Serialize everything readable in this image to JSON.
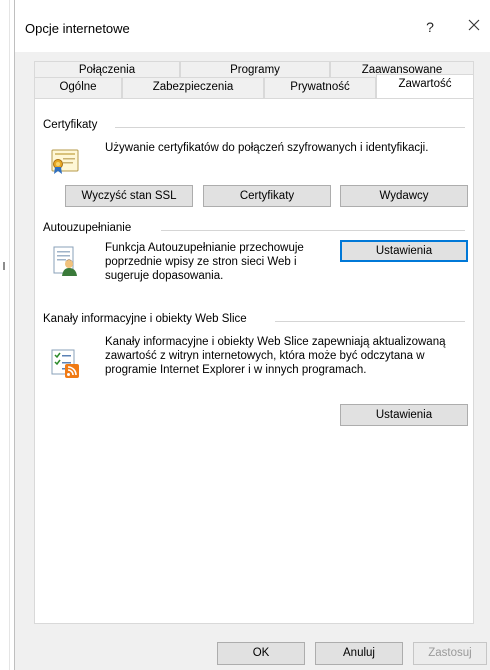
{
  "window": {
    "title": "Opcje internetowe",
    "help_label": "?"
  },
  "tabs": {
    "top_row": [
      {
        "label": "Połączenia"
      },
      {
        "label": "Programy"
      },
      {
        "label": "Zaawansowane"
      }
    ],
    "bottom_row": [
      {
        "label": "Ogólne"
      },
      {
        "label": "Zabezpieczenia"
      },
      {
        "label": "Prywatność"
      },
      {
        "label": "Zawartość",
        "active": true
      }
    ]
  },
  "certificates": {
    "title": "Certyfikaty",
    "icon": "certificate-icon",
    "description": "Używanie certyfikatów do połączeń szyfrowanych i identyfikacji.",
    "buttons": {
      "clear_ssl": "Wyczyść stan SSL",
      "certificates": "Certyfikaty",
      "publishers": "Wydawcy"
    }
  },
  "autocomplete": {
    "title": "Autouzupełnianie",
    "icon": "autocomplete-icon",
    "description": "Funkcja Autouzupełnianie przechowuje poprzednie wpisy ze stron sieci Web i sugeruje dopasowania.",
    "settings_button": "Ustawienia"
  },
  "feeds": {
    "title": "Kanały informacyjne i obiekty Web Slice",
    "icon": "feeds-icon",
    "description": "Kanały informacyjne i obiekty Web Slice zapewniają aktualizowaną zawartość z witryn internetowych, która może być odczytana w programie Internet Explorer i w innych programach.",
    "settings_button": "Ustawienia"
  },
  "footer": {
    "ok": "OK",
    "cancel": "Anuluj",
    "apply": "Zastosuj"
  },
  "colors": {
    "accent": "#0078d7",
    "dialog_bg": "#f0f0f0",
    "button_bg": "#e1e1e1"
  }
}
